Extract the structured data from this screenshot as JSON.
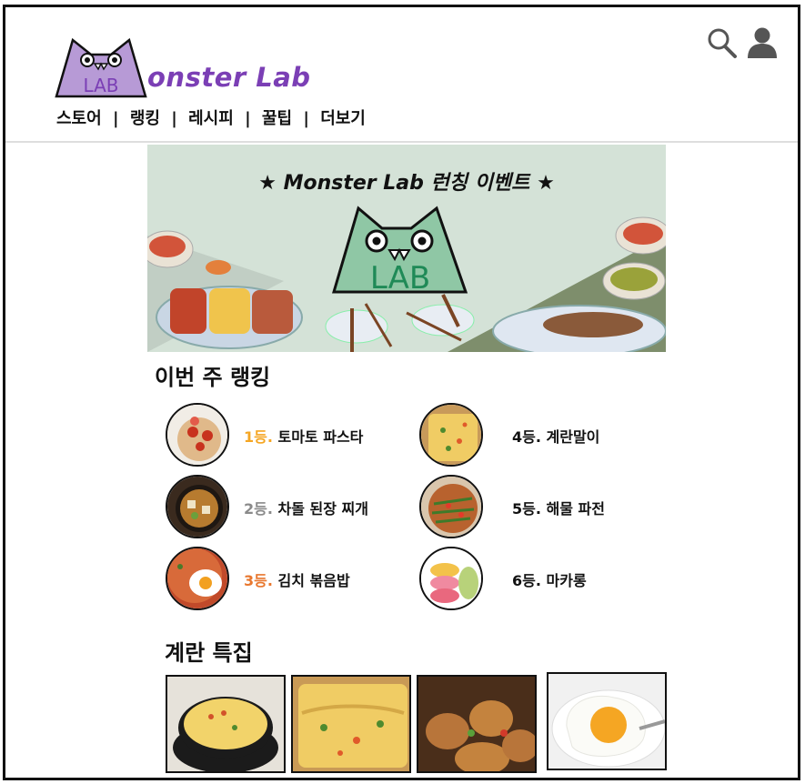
{
  "header": {
    "logo_badge_text": "LAB",
    "logo_text": "onster Lab",
    "nav": [
      "스토어",
      "랭킹",
      "레시피",
      "꿀팁",
      "더보기"
    ],
    "nav_separator": "|",
    "icons": [
      "search-icon",
      "user-icon"
    ]
  },
  "banner": {
    "title": "★ Monster Lab 런칭 이벤트 ★",
    "badge_text": "LAB"
  },
  "ranking": {
    "title": "이번 주 랭킹",
    "items": [
      {
        "rank": "1등.",
        "name": " 토마토 파스타",
        "color": "#f5a623"
      },
      {
        "rank": "2등.",
        "name": " 차돌 된장 찌개",
        "color": "#8a8a8a"
      },
      {
        "rank": "3등.",
        "name": " 김치 볶음밥",
        "color": "#e8772e"
      },
      {
        "rank": "4등.",
        "name": " 계란말이",
        "color": "#111111"
      },
      {
        "rank": "5등.",
        "name": " 해물 파전",
        "color": "#111111"
      },
      {
        "rank": "6등.",
        "name": " 마카롱",
        "color": "#111111"
      }
    ]
  },
  "egg_feature": {
    "title": "계란 특집"
  },
  "colors": {
    "brand_purple": "#7b3fb5",
    "logo_fill": "#b79ad6",
    "banner_bg": "#d4e2d7",
    "monster_green": "#8fc7a5"
  }
}
